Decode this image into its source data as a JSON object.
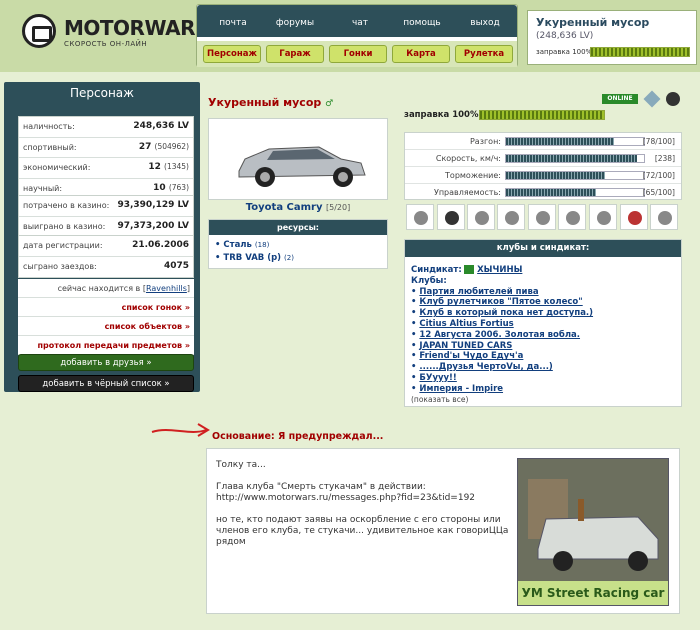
{
  "logo": {
    "name": "MOTORWARS.RU",
    "tagline": "СКОРОСТЬ ОН-ЛАЙН"
  },
  "nav": {
    "top": [
      "почта",
      "форумы",
      "чат",
      "помощь",
      "выход"
    ],
    "bottom": [
      "Персонаж",
      "Гараж",
      "Гонки",
      "Карта",
      "Рулетка"
    ]
  },
  "user": {
    "name": "Укуренный мусор",
    "value": "(248,636 LV)",
    "fuel_label": "заправка 100%",
    "fuel_level": 1.0
  },
  "left": {
    "title": "Персонаж",
    "stats1": [
      {
        "k": "наличность:",
        "v": "248,636 LV",
        "s": ""
      },
      {
        "k": "спортивный:",
        "v": "27",
        "s": "(504962)"
      },
      {
        "k": "экономический:",
        "v": "12",
        "s": "(1345)"
      },
      {
        "k": "научный:",
        "v": "10",
        "s": "(763)"
      }
    ],
    "stats2": [
      {
        "k": "потрачено в казино:",
        "v": "93,390,129 LV"
      },
      {
        "k": "выиграно в казино:",
        "v": "97,373,200 LV"
      }
    ],
    "stats3": [
      {
        "k": "дата регистрации:",
        "v": "21.06.2006"
      },
      {
        "k": "сыграно заездов:",
        "v": "4075"
      }
    ],
    "location_prefix": "сейчас находится в",
    "location": "Ravenhills",
    "links": [
      "список гонок »",
      "список объектов »",
      "протокол передачи предметов »"
    ],
    "btn_friends": "добавить в друзья »",
    "btn_black": "добавить в чёрный список »"
  },
  "profile": {
    "name": "Укуренный мусор",
    "car": "Toyota Camry",
    "car_num": "[5/20]",
    "online": "ONLINE",
    "fuel": "заправка 100%",
    "fuel_level": 1.0
  },
  "resources": {
    "title": "ресурсы:",
    "items": [
      {
        "name": "Сталь",
        "count": "(18)"
      },
      {
        "name": "TRB VAB (p)",
        "count": "(2)"
      }
    ]
  },
  "stats": [
    {
      "k": "Разгон:",
      "v": "[78/100]",
      "level": 0.78
    },
    {
      "k": "Скорость, км/ч:",
      "v": "[238]",
      "level": 0.95
    },
    {
      "k": "Торможение:",
      "v": "[72/100]",
      "level": 0.72
    },
    {
      "k": "Управляемость:",
      "v": "[65/100]",
      "level": 0.65
    }
  ],
  "clubs": {
    "title": "клубы и синдикат:",
    "syndicate_label": "Синдикат:",
    "syndicate": "ХЫЧИНЫ",
    "clubs_label": "Клубы:",
    "list": [
      "Партия любителей пива",
      "Клуб рулетчиков \"Пятое колесо\"",
      "Клуб в который пока нет доступа.)",
      "Citius Altius Fortius",
      "12 Августа 2006. Золотая вобла.",
      "JAPAN TUNED CARS",
      "Friend'ы Чудо Едуч'а",
      "......Друзья ЧертоVы, да...)",
      "БУууу!!",
      "Империя - Impire"
    ],
    "show_all": "(показать все)"
  },
  "reason": "Основание: Я предупреждал...",
  "message": {
    "p1": "Толку та...",
    "p2": "Глава клуба \"Смерть стукачам\" в действии: http://www.motorwars.ru/messages.php?fid=23&tid=192",
    "p3": "но те, кто подают заявы на оскорбление с его стороны или членов его клуба, те стукачи... удивительное как говориЦЦа рядом",
    "image_caption": "УМ Street Racing car"
  }
}
